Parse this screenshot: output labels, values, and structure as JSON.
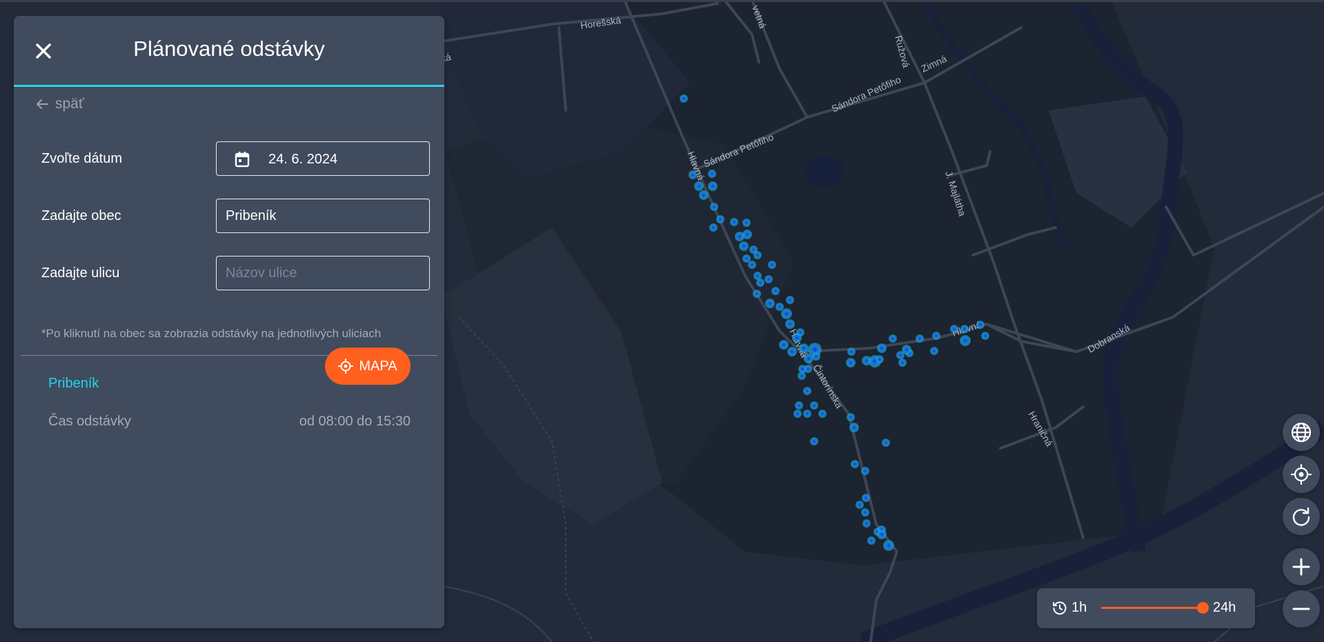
{
  "panel": {
    "title": "Plánované odstávky",
    "back_label": "späť",
    "fields": {
      "date_label": "Zvoľte dátum",
      "date_value": "24. 6. 2024",
      "municipality_label": "Zadajte obec",
      "municipality_value": "Pribeník",
      "street_label": "Zadajte ulicu",
      "street_placeholder": "Názov ulice"
    },
    "note": "*Po kliknutí na obec sa zobrazia odstávky na jednotlivých uliciach",
    "result": {
      "name": "Pribeník",
      "map_button": "MAPA",
      "time_label": "Čas odstávky",
      "time_value": "od 08:00 do 15:30"
    }
  },
  "map": {
    "street_labels": [
      "Horešská",
      "Ružová",
      "Zimná",
      "Sándora Petőfiho",
      "Sándora Petőfiho",
      "Hlavná",
      "J. Majlátha",
      "Hlavná",
      "Hlavná",
      "Čintorínska",
      "Dobranská",
      "Hraničná",
      "vetná",
      "ká"
    ]
  },
  "controls": {
    "icons": [
      "globe-icon",
      "locate-icon",
      "refresh-icon",
      "zoom-in-icon",
      "zoom-out-icon"
    ],
    "time_range": {
      "min_label": "1h",
      "max_label": "24h",
      "value_fraction": 1.0
    }
  },
  "colors": {
    "accent": "#29d3e8",
    "primary": "#ff5f1f",
    "panel": "#414b5e",
    "map_background": "#232b3b"
  }
}
